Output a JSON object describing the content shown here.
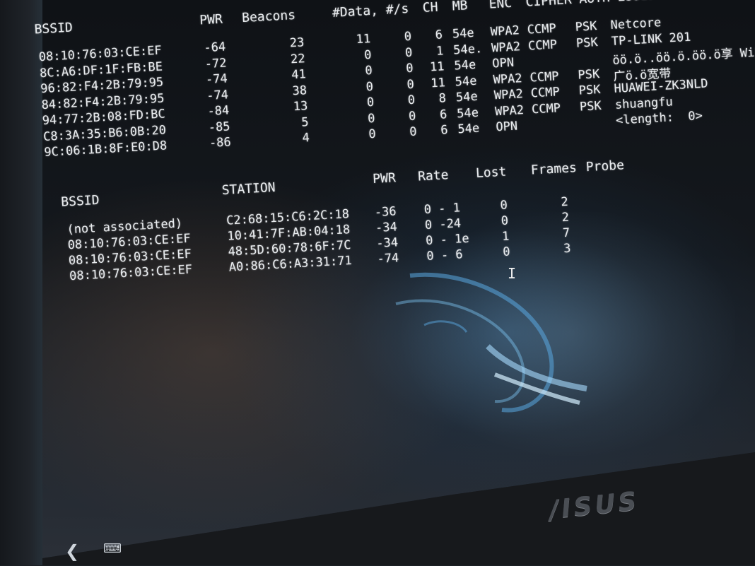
{
  "terminal": {
    "ap_header": {
      "bssid": "BSSID",
      "pwr": "PWR",
      "beacons": "Beacons",
      "data": "#Data, #/s",
      "ch": "CH",
      "mb": "MB",
      "enc": "ENC",
      "cipher_auth_essid": "CIPHER AUTH ESSID"
    },
    "access_points": [
      {
        "bssid": "08:10:76:03:CE:EF",
        "pwr": "-64",
        "beacons": "23",
        "data": "11",
        "rate": "0",
        "ch": "6",
        "mb": "54e",
        "enc": "WPA2",
        "cipher": "CCMP",
        "auth": "PSK",
        "essid": "Netcore"
      },
      {
        "bssid": "8C:A6:DF:1F:FB:BE",
        "pwr": "-72",
        "beacons": "22",
        "data": "0",
        "rate": "0",
        "ch": "1",
        "mb": "54e.",
        "enc": "WPA2",
        "cipher": "CCMP",
        "auth": "PSK",
        "essid": "TP-LINK 201"
      },
      {
        "bssid": "96:82:F4:2B:79:95",
        "pwr": "-74",
        "beacons": "41",
        "data": "0",
        "rate": "0",
        "ch": "11",
        "mb": "54e",
        "enc": "OPN",
        "cipher": "",
        "auth": "",
        "essid": "öö.ö..öö.ö.öö.ö享 WiFi"
      },
      {
        "bssid": "84:82:F4:2B:79:95",
        "pwr": "-74",
        "beacons": "38",
        "data": "0",
        "rate": "0",
        "ch": "11",
        "mb": "54e",
        "enc": "WPA2",
        "cipher": "CCMP",
        "auth": "PSK",
        "essid": "广ö.ö宽带"
      },
      {
        "bssid": "94:77:2B:08:FD:BC",
        "pwr": "-84",
        "beacons": "13",
        "data": "0",
        "rate": "0",
        "ch": "8",
        "mb": "54e",
        "enc": "WPA2",
        "cipher": "CCMP",
        "auth": "PSK",
        "essid": "HUAWEI-ZK3NLD"
      },
      {
        "bssid": "C8:3A:35:B6:0B:20",
        "pwr": "-85",
        "beacons": "5",
        "data": "0",
        "rate": "0",
        "ch": "6",
        "mb": "54e",
        "enc": "WPA2",
        "cipher": "CCMP",
        "auth": "PSK",
        "essid": "shuangfu"
      },
      {
        "bssid": "9C:06:1B:8F:E0:D8",
        "pwr": "-86",
        "beacons": "4",
        "data": "0",
        "rate": "0",
        "ch": "6",
        "mb": "54e",
        "enc": "OPN",
        "cipher": "",
        "auth": "",
        "essid": "<length:  0>"
      }
    ],
    "sta_header": {
      "bssid": "BSSID",
      "station": "STATION",
      "pwr": "PWR",
      "rate": "Rate",
      "lost": "Lost",
      "frames": "Frames",
      "probe": "Probe"
    },
    "stations": [
      {
        "bssid": "(not associated)",
        "station": "C2:68:15:C6:2C:18",
        "pwr": "-36",
        "rate": "0 - 1",
        "lost": "0",
        "frames": "2"
      },
      {
        "bssid": "08:10:76:03:CE:EF",
        "station": "10:41:7F:AB:04:18",
        "pwr": "-34",
        "rate": "0 -24",
        "lost": "0",
        "frames": "2"
      },
      {
        "bssid": "08:10:76:03:CE:EF",
        "station": "48:5D:60:78:6F:7C",
        "pwr": "-34",
        "rate": "0 - 1e",
        "lost": "1",
        "frames": "7"
      },
      {
        "bssid": "08:10:76:03:CE:EF",
        "station": "A0:86:C6:A3:31:71",
        "pwr": "-74",
        "rate": "0 - 6",
        "lost": "0",
        "frames": "3"
      }
    ]
  },
  "laptop": {
    "brand_logo_text": "/ISUS"
  },
  "taskbar": {
    "back_icon": "chevron-left-icon",
    "keyboard_icon": "keyboard-icon"
  },
  "colors": {
    "terminal_text": "#e9ecef",
    "glow": "#5aa8e0"
  }
}
